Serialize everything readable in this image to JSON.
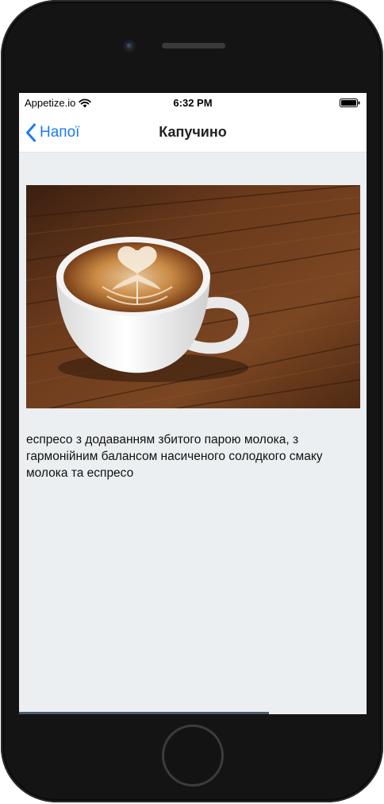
{
  "status_bar": {
    "carrier": "Appetize.io",
    "time": "6:32 PM",
    "wifi_icon": "wifi-icon",
    "battery_icon": "battery-icon"
  },
  "nav": {
    "back_label": "Напої",
    "back_icon": "chevron-left-icon",
    "title": "Капучино"
  },
  "detail": {
    "image_alt": "cappuccino-with-latte-art",
    "description": "еспресо з додаванням збитого парою молока, з гармонійним балансом насиченого солодкого смаку молока та еспресо"
  },
  "colors": {
    "accent": "#1a7cf5",
    "screen_background": "#ebeff1",
    "device_frame": "#141414"
  },
  "scroll": {
    "position_fraction": 0.72
  }
}
